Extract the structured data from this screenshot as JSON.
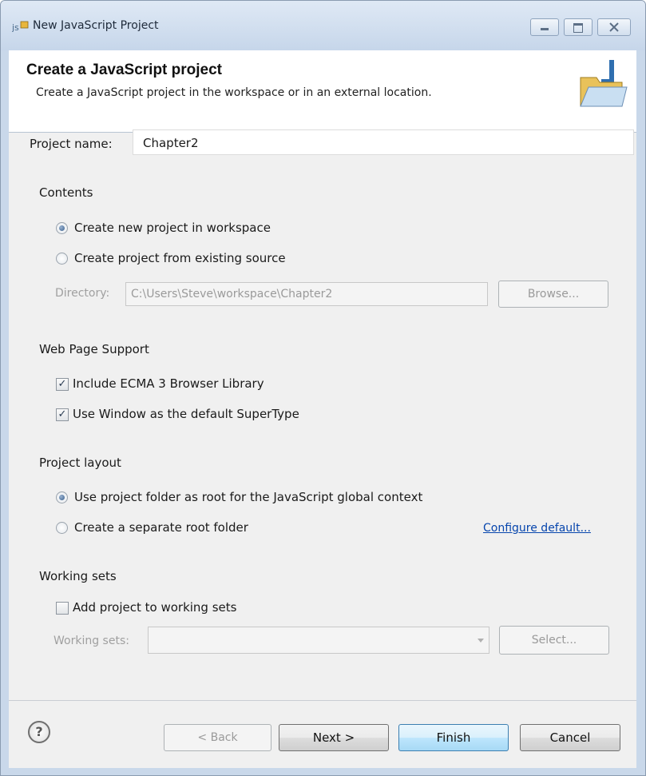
{
  "window": {
    "title": "New JavaScript Project",
    "controls": [
      "minimize-icon",
      "maximize-icon",
      "close-icon"
    ]
  },
  "banner": {
    "title": "Create a JavaScript project",
    "description": "Create a JavaScript project in the workspace or in an external location."
  },
  "project": {
    "name_label": "Project name:",
    "name_value": "Chapter2"
  },
  "contents": {
    "heading": "Contents",
    "option_new": "Create new project in workspace",
    "option_existing": "Create project from existing source",
    "selected": "option_new",
    "directory_label": "Directory:",
    "directory_value": "C:\\Users\\Steve\\workspace\\Chapter2",
    "browse_label": "Browse..."
  },
  "web_support": {
    "heading": "Web Page Support",
    "ecma_label": "Include ECMA 3 Browser Library",
    "ecma_checked": true,
    "window_label": "Use Window as the default SuperType",
    "window_checked": true
  },
  "layout": {
    "heading": "Project layout",
    "option_root": "Use project folder as root for the JavaScript global context",
    "option_separate": "Create a separate root folder",
    "selected": "option_root",
    "configure_link": "Configure default..."
  },
  "working_sets": {
    "heading": "Working sets",
    "add_label": "Add project to working sets",
    "add_checked": false,
    "sets_label": "Working sets:",
    "sets_value": "",
    "select_label": "Select..."
  },
  "footer": {
    "help_icon": "help-icon",
    "back_label": "< Back",
    "next_label": "Next >",
    "finish_label": "Finish",
    "cancel_label": "Cancel"
  }
}
